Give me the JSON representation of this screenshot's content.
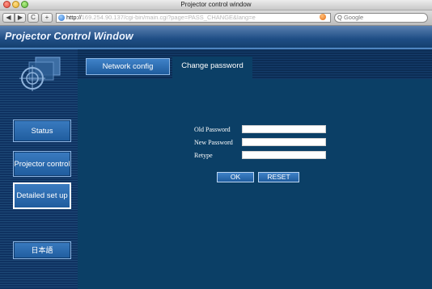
{
  "window": {
    "title": "Projector control window"
  },
  "browser": {
    "back_glyph": "◀",
    "forward_glyph": "▶",
    "reload_glyph": "C",
    "addtab_glyph": "+",
    "url_prefix": "http://",
    "url_rest": "169.254.90.137/cgi-bin/main.cgi?page=PASS_CHANGE&lang=e",
    "search_glass": "Q",
    "search_placeholder": "Google"
  },
  "page": {
    "header_title": "Projector Control Window"
  },
  "sidebar": {
    "items": [
      {
        "label": "Status"
      },
      {
        "label": "Projector control"
      },
      {
        "label": "Detailed set up"
      },
      {
        "label": "日本語"
      }
    ],
    "active_index": 2
  },
  "tabs": [
    {
      "label": "Network config",
      "selected": false
    },
    {
      "label": "Change password",
      "selected": true
    }
  ],
  "form": {
    "fields": [
      {
        "label": "Old Password",
        "value": ""
      },
      {
        "label": "New Password",
        "value": ""
      },
      {
        "label": "Retype",
        "value": ""
      }
    ],
    "ok_label": "OK",
    "reset_label": "RESET"
  },
  "colors": {
    "page_background": "#0a2a4f",
    "content_background": "#0b3f66",
    "button_blue": "#2a6cb0",
    "header_blue": "#1f4e85"
  }
}
